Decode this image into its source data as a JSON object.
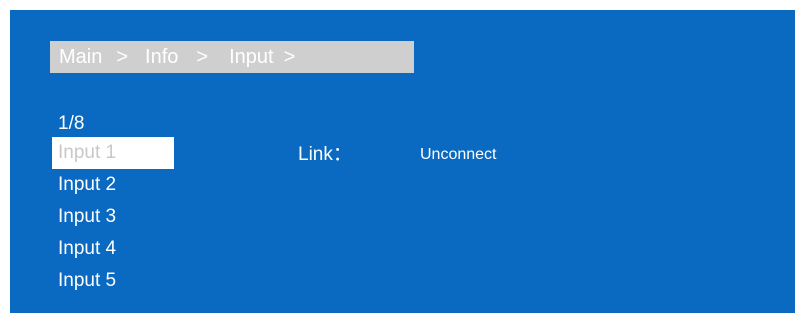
{
  "breadcrumb": {
    "items": [
      "Main",
      "Info",
      "Input"
    ],
    "separator": ">"
  },
  "page_indicator": "1/8",
  "inputs": [
    {
      "label": "Input 1",
      "selected": true
    },
    {
      "label": "Input 2",
      "selected": false
    },
    {
      "label": "Input 3",
      "selected": false
    },
    {
      "label": "Input 4",
      "selected": false
    },
    {
      "label": "Input 5",
      "selected": false
    }
  ],
  "detail": {
    "link_label": "Link：",
    "link_value": "Unconnect"
  },
  "colors": {
    "background": "#0a69c0",
    "breadcrumb_bg": "#cfcfcf",
    "selected_bg": "#ffffff",
    "selected_text": "#c8c8c8",
    "text": "#ffffff"
  }
}
